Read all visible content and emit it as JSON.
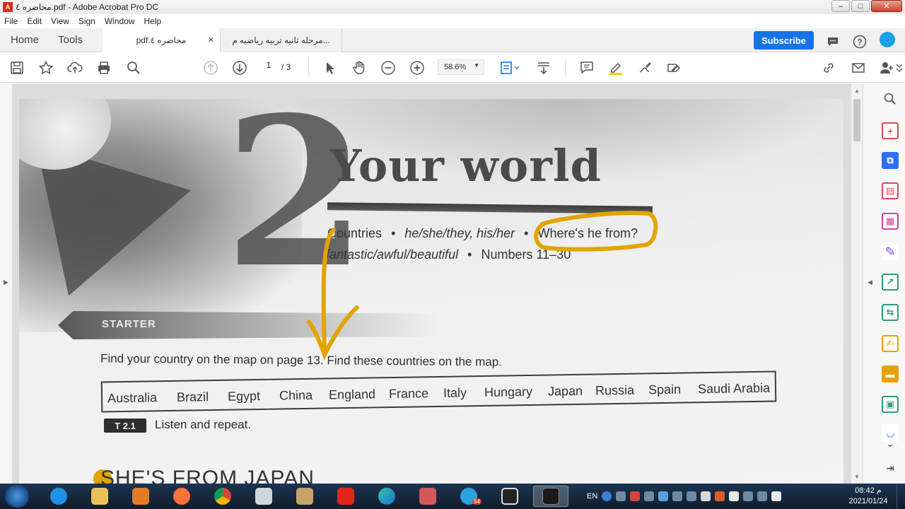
{
  "window": {
    "title": "محاضره ٤.pdf - Adobe Acrobat Pro DC",
    "controls": [
      "–",
      "□",
      "✕"
    ]
  },
  "menu": [
    "File",
    "Edit",
    "View",
    "Sign",
    "Window",
    "Help"
  ],
  "tabs": {
    "home": "Home",
    "tools": "Tools",
    "documents": [
      {
        "label": "pdf.محاضره ٤",
        "close": "✕"
      },
      {
        "label": "مرحله ثانيه تربيه رياضيه م..."
      }
    ],
    "subscribe": "Subscribe"
  },
  "toolbar": {
    "page_current": "1",
    "page_total": "/ 3",
    "zoom": "58.6%"
  },
  "document": {
    "unit_number": "2",
    "heading": "Your world",
    "topics_line1": {
      "a": "Countries",
      "b": "he/she/they, his/her",
      "c": "Where's he from?"
    },
    "topics_line2": {
      "a": "fantastic/awful/beautiful",
      "b": "Numbers 11–30"
    },
    "bullet": "•",
    "starter": "STARTER",
    "instruction": "Find your country on the map on page 13. Find these countries on the map.",
    "countries": [
      "Australia",
      "Brazil",
      "Egypt",
      "China",
      "England",
      "France",
      "Italy",
      "Hungary",
      "Japan",
      "Russia",
      "Spain",
      "Saudi Arabia"
    ],
    "track": "T 2.1",
    "listen": "Listen and repeat.",
    "next_section": "SHE'S FROM JAPAN",
    "annotation_color": "#E3A300"
  },
  "taskbar": {
    "language": "EN",
    "clock_time": "08:42 م",
    "clock_date": "2021/01/24",
    "telegram_badge": "54"
  }
}
